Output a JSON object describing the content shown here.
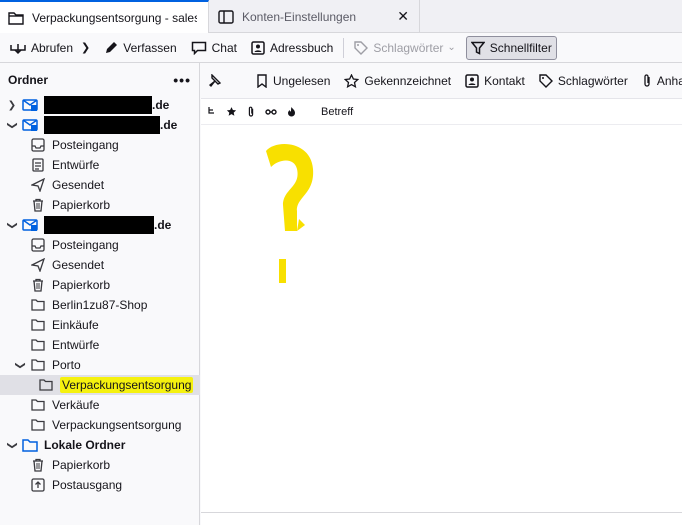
{
  "tabs": [
    {
      "label": "Verpackungsentsorgung - sales",
      "active": true
    },
    {
      "label": "Konten-Einstellungen",
      "active": false
    }
  ],
  "toolbar": {
    "get_messages": "Abrufen",
    "write": "Verfassen",
    "chat": "Chat",
    "address_book": "Adressbuch",
    "tags": "Schlagwörter",
    "quick_filter": "Schnellfilter"
  },
  "folder_pane": {
    "title": "Ordner",
    "menu": "•••",
    "accounts": [
      {
        "suffix": ".de"
      },
      {
        "suffix": ".de"
      },
      {
        "suffix": ".de"
      }
    ],
    "folders": {
      "inbox": "Posteingang",
      "drafts": "Entwürfe",
      "sent": "Gesendet",
      "trash": "Papierkorb",
      "shop": "Berlin1zu87-Shop",
      "purchases": "Einkäufe",
      "porto": "Porto",
      "packaging_selected": "Verpackungsentsorgung",
      "sales": "Verkäufe",
      "packaging": "Verpackungsentsorgung",
      "local": "Lokale Ordner",
      "outbox": "Postausgang"
    }
  },
  "filter_bar": {
    "unread": "Ungelesen",
    "starred": "Gekennzeichnet",
    "contact": "Kontakt",
    "tags": "Schlagwörter",
    "attachment": "Anha"
  },
  "columns": {
    "subject": "Betreff"
  },
  "annotation": {
    "question_mark": "?"
  },
  "colors": {
    "accent": "#0061e0",
    "highlight": "#f5f10f",
    "question": "#f8e000"
  }
}
